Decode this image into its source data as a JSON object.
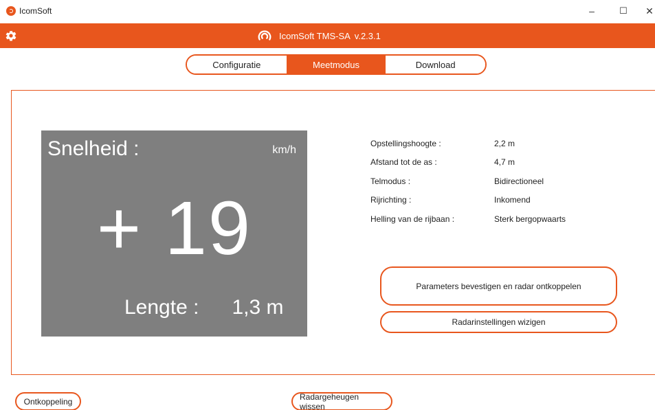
{
  "window": {
    "title": "IcomSoft",
    "minimize": "–",
    "maximize": "☐",
    "close": "✕"
  },
  "header": {
    "app_name": "IcomSoft TMS-SA",
    "version": "v.2.3.1",
    "settings_icon": "gear-icon",
    "brand_color": "#e8561d"
  },
  "tabs": [
    {
      "label": "Configuratie",
      "active": false
    },
    {
      "label": "Meetmodus",
      "active": true
    },
    {
      "label": "Download",
      "active": false
    }
  ],
  "measurement": {
    "speed_label": "Snelheid :",
    "speed_unit": "km/h",
    "speed_value": "+ 19",
    "length_label": "Lengte :",
    "length_value": "1,3 m"
  },
  "parameters": [
    {
      "key": "Opstellingshoogte :",
      "value": "2,2 m"
    },
    {
      "key": "Afstand tot de as :",
      "value": "4,7 m"
    },
    {
      "key": "Telmodus :",
      "value": "Bidirectioneel"
    },
    {
      "key": "Rijrichting :",
      "value": "Inkomend"
    },
    {
      "key": "Helling van de rijbaan :",
      "value": "Sterk bergopwaarts"
    }
  ],
  "buttons": {
    "confirm": "Parameters bevestigen en radar ontkoppelen",
    "radar_settings": "Radarinstellingen wizigen",
    "disconnect": "Ontkoppeling",
    "wipe_memory": "Radargeheugen wissen"
  }
}
